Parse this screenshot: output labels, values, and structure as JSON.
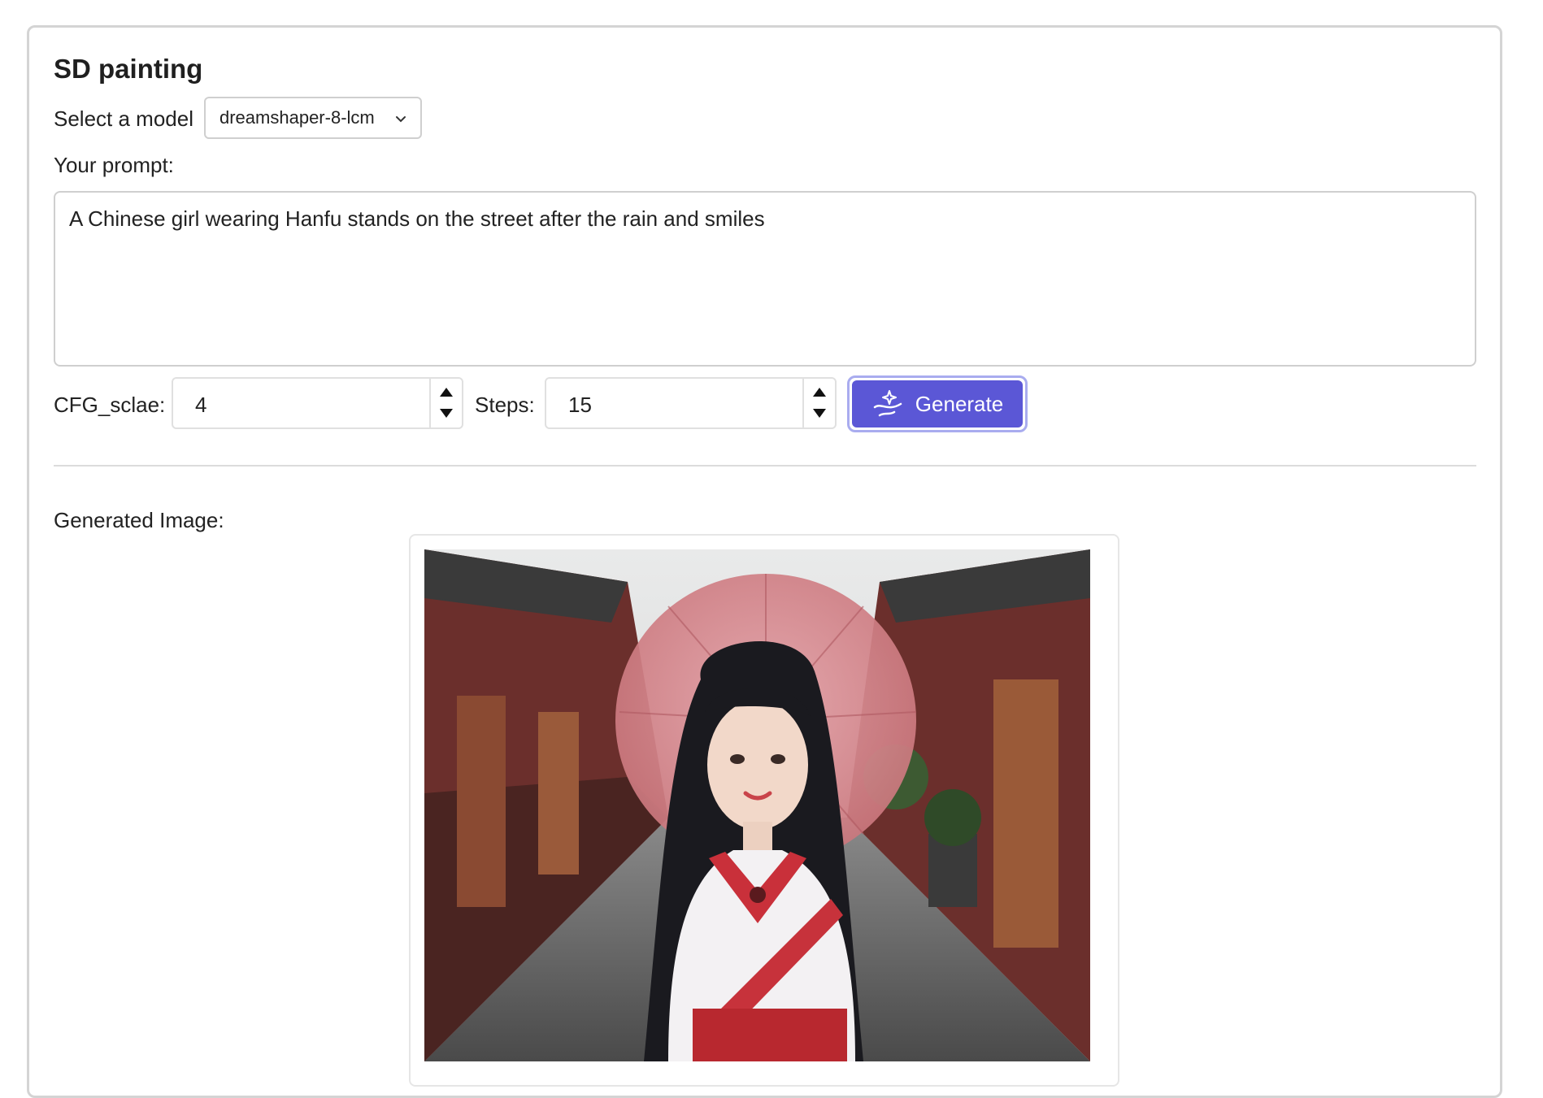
{
  "panel": {
    "title": "SD painting"
  },
  "model": {
    "label": "Select a model",
    "selected": "dreamshaper-8-lcm",
    "chevron_icon": "chevron-down-icon"
  },
  "prompt": {
    "label": "Your prompt:",
    "value": "A Chinese girl wearing Hanfu stands on the street after the rain and smiles"
  },
  "cfg": {
    "label": "CFG_sclae:",
    "value": "4"
  },
  "steps": {
    "label": "Steps:",
    "value": "15"
  },
  "generate": {
    "label": "Generate",
    "icon": "sparkle-icon",
    "color": "#5b57d6"
  },
  "result": {
    "label": "Generated Image:"
  }
}
